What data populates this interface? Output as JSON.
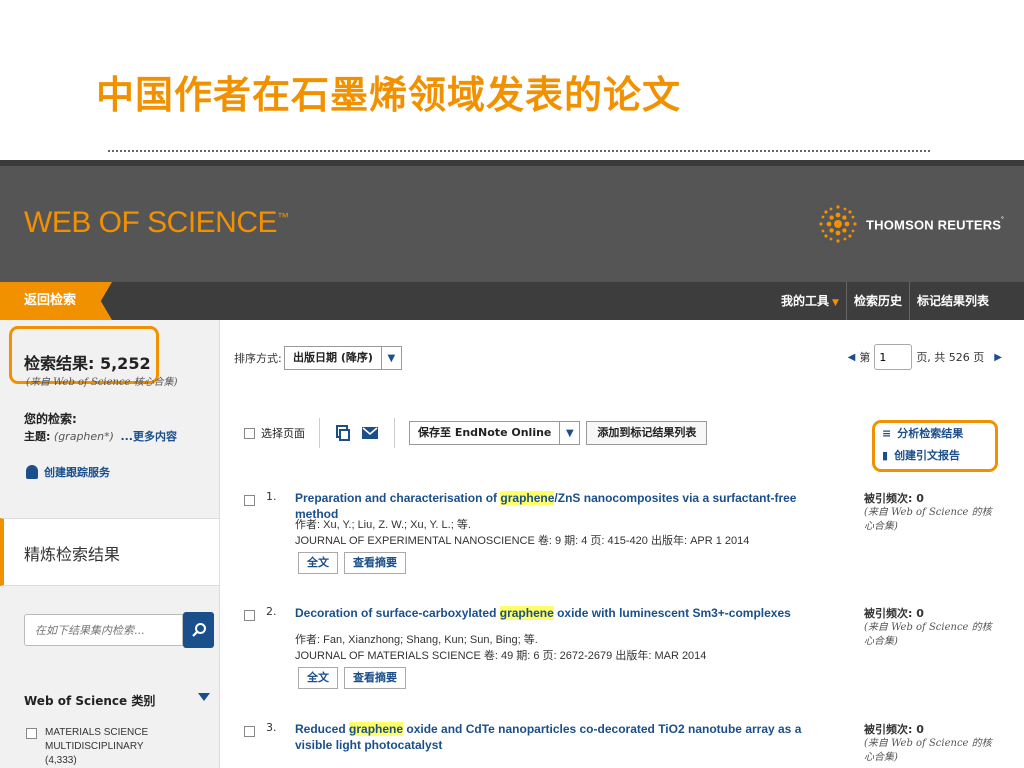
{
  "slide": {
    "title": "中国作者在石墨烯领域发表的论文"
  },
  "header": {
    "logo": "WEB OF SCIENCE",
    "logo_tm": "™",
    "publisher": "THOMSON REUTERS",
    "publisher_tm": "˚"
  },
  "nav": {
    "back": "返回检索",
    "items": [
      {
        "label": "我的工具",
        "caret": "▼"
      },
      {
        "label": "检索历史"
      },
      {
        "label": "标记结果列表"
      }
    ]
  },
  "sidebar": {
    "results_label": "检索结果: 5,252",
    "results_source": "(来自 Web of Science 核心合集)",
    "your_search_label": "您的检索:",
    "topic_label": "主题:",
    "topic_value": "(graphen*)",
    "more": "...更多内容",
    "alert": "创建跟踪服务",
    "refine": "精炼检索结果",
    "search_placeholder": "在如下结果集内检索...",
    "category_header": "Web of Science 类别",
    "categories": [
      {
        "label": "MATERIALS SCIENCE MULTIDISCIPLINARY (4,333)"
      }
    ]
  },
  "toolbar": {
    "sort_label": "排序方式:",
    "sort_value": "出版日期 (降序)",
    "page_prefix": "第",
    "page_value": "1",
    "page_suffix": "页, 共  526  页",
    "select_page": "选择页面",
    "save_endnote": "保存至 EndNote Online",
    "add_marked": "添加到标记结果列表",
    "analyze": "分析检索结果",
    "citation_report": "创建引文报告"
  },
  "records": [
    {
      "num": "1.",
      "title_before": "Preparation and characterisation of ",
      "title_highlight": "graphene",
      "title_after": "/ZnS nanocomposites via a surfactant-free method",
      "authors": "作者: Xu, Y.; Liu, Z. W.; Xu, Y. L.; 等.",
      "source": "JOURNAL OF EXPERIMENTAL NANOSCIENCE  卷: 9  期: 4  页: 415-420  出版年: APR 1 2014",
      "fulltext": "全文",
      "abstract": "查看摘要",
      "cited": "被引频次: 0",
      "cited_source": "(来自 Web of Science 的核心合集)"
    },
    {
      "num": "2.",
      "title_before": "Decoration of surface-carboxylated ",
      "title_highlight": "graphene",
      "title_after": " oxide with luminescent Sm3+-complexes",
      "authors": "作者: Fan, Xianzhong; Shang, Kun; Sun, Bing; 等.",
      "source": "JOURNAL OF MATERIALS SCIENCE  卷: 49  期: 6  页: 2672-2679  出版年: MAR 2014",
      "fulltext": "全文",
      "abstract": "查看摘要",
      "cited": "被引频次: 0",
      "cited_source": "(来自 Web of Science 的核心合集)"
    },
    {
      "num": "3.",
      "title_before": "Reduced ",
      "title_highlight": "graphene",
      "title_after": " oxide and CdTe nanoparticles co-decorated TiO2 nanotube array as a visible light photocatalyst",
      "cited": "被引频次: 0",
      "cited_source": "(来自 Web of Science 的核心合集)"
    }
  ],
  "colors": {
    "accent": "#f29100",
    "link": "#1a4f8c",
    "header_bg": "#555555",
    "nav_bg": "#3d3d3d",
    "highlight": "#ffff66"
  },
  "icons": [
    "search-icon",
    "bell-icon",
    "print-icon",
    "email-icon",
    "list-icon",
    "bar-chart-icon",
    "chevron-down-icon",
    "triangle-left-icon",
    "triangle-right-icon"
  ]
}
